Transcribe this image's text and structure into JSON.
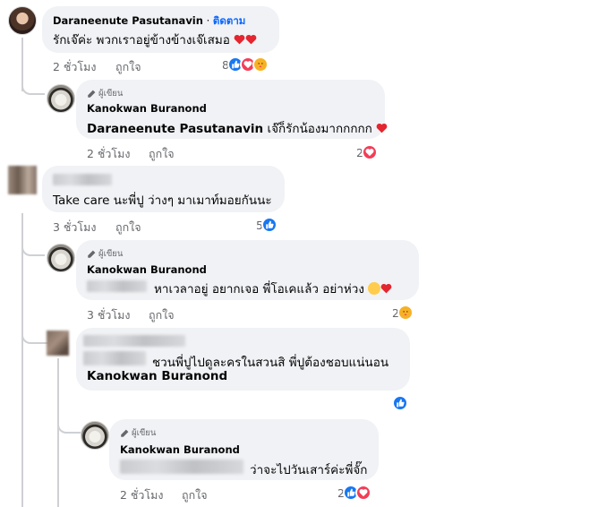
{
  "comments": [
    {
      "author": "Daraneenute Pasutanavin",
      "follow_label": "ติดตาม",
      "text": "รักเจ๊ค่ะ พวกเราอยู่ข้างข้างเจ๊เสมอ",
      "time": "2 ชั่วโมง",
      "like_label": "ถูกใจ",
      "reaction_count": "8",
      "reactions": [
        "like-icon",
        "love-icon",
        "care-icon"
      ]
    },
    {
      "badge": "ผู้เขียน",
      "author": "Kanokwan Buranond",
      "mention": "Daraneenute Pasutanavin",
      "text": "เจ๊ก็รักน้องมากกกกก",
      "time": "2 ชั่วโมง",
      "like_label": "ถูกใจ",
      "reaction_count": "2",
      "reactions": [
        "love-icon"
      ]
    },
    {
      "text": "Take care นะพี่ปู ว่างๆ มาเมาท์มอยกันนะ",
      "time": "3 ชั่วโมง",
      "like_label": "ถูกใจ",
      "reaction_count": "5",
      "reactions": [
        "like-icon"
      ]
    },
    {
      "badge": "ผู้เขียน",
      "author": "Kanokwan Buranond",
      "text": "หาเวลาอยู่ อยากเจอ พี่โอเคแล้ว อย่าห่วง",
      "time": "3 ชั่วโมง",
      "like_label": "ถูกใจ",
      "reaction_count": "2",
      "reactions": [
        "care-icon"
      ]
    },
    {
      "text": "ชวนพี่ปูไปดูละครในสวนสิ พี่ปูต้องชอบแน่นอน",
      "mention": "Kanokwan Buranond",
      "reactions": [
        "like-icon"
      ]
    },
    {
      "badge": "ผู้เขียน",
      "author": "Kanokwan Buranond",
      "text": "ว่าจะไปวันเสาร์ค่ะพี่จั๊ก",
      "time": "2 ชั่วโมง",
      "like_label": "ถูกใจ",
      "reaction_count": "2",
      "reactions": [
        "like-icon",
        "love-icon"
      ]
    }
  ],
  "colors": {
    "bubble": "#f0f2f5",
    "secondary_text": "#65676b",
    "link_blue": "#0866ff",
    "like_blue": "#1877f2",
    "love_red": "#f33e58",
    "care_yellow": "#f7b125"
  }
}
